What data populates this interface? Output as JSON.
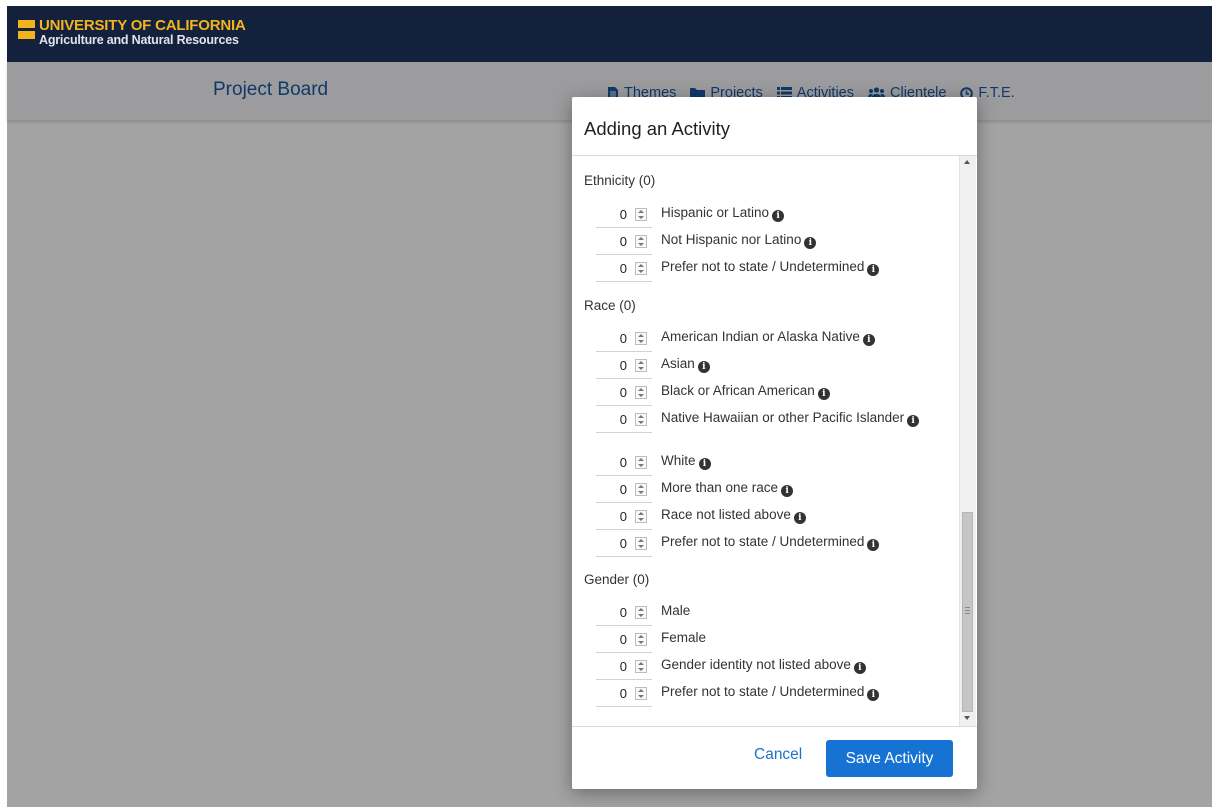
{
  "header": {
    "logo_line1": "UNIVERSITY OF CALIFORNIA",
    "logo_line2": "Agriculture and Natural Resources"
  },
  "navbar": {
    "brand": "Project Board",
    "links": [
      "Themes",
      "Projects",
      "Activities",
      "Clientele",
      "F.T.E."
    ]
  },
  "modal": {
    "title": "Adding an Activity",
    "sections": [
      {
        "title": "Ethnicity (0)",
        "items": [
          {
            "value": "0",
            "label": "Hispanic or Latino"
          },
          {
            "value": "0",
            "label": "Not Hispanic nor Latino"
          },
          {
            "value": "0",
            "label": "Prefer not to state / Undetermined"
          }
        ]
      },
      {
        "title": "Race (0)",
        "items": [
          {
            "value": "0",
            "label": "American Indian or Alaska Native"
          },
          {
            "value": "0",
            "label": "Asian"
          },
          {
            "value": "0",
            "label": "Black or African American"
          },
          {
            "value": "0",
            "label": "Native Hawaiian or other Pacific Islander"
          },
          {
            "value": "0",
            "label": "White"
          },
          {
            "value": "0",
            "label": "More than one race"
          },
          {
            "value": "0",
            "label": "Race not listed above"
          },
          {
            "value": "0",
            "label": "Prefer not to state / Undetermined"
          }
        ]
      },
      {
        "title": "Gender (0)",
        "items": [
          {
            "value": "0",
            "label": "Male"
          },
          {
            "value": "0",
            "label": "Female"
          },
          {
            "value": "0",
            "label": "Gender identity not listed above"
          },
          {
            "value": "0",
            "label": "Prefer not to state / Undetermined"
          }
        ]
      }
    ],
    "cancel_label": "Cancel",
    "save_label": "Save Activity"
  }
}
